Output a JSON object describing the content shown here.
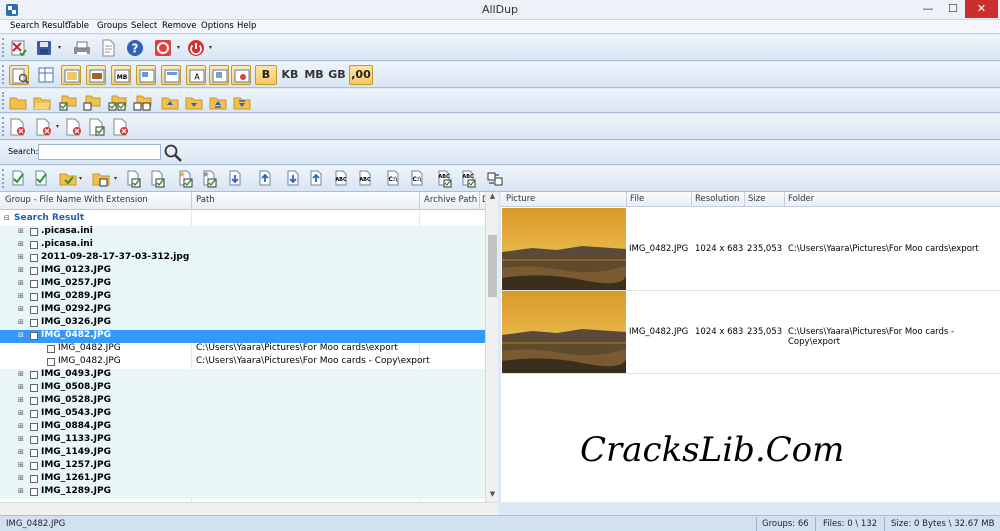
{
  "window": {
    "title": "AllDup",
    "min_glyph": "—",
    "max_glyph": "☐",
    "close_glyph": "✕"
  },
  "menu": [
    "Search Result",
    "Table",
    "Groups",
    "Select",
    "Remove",
    "Options",
    "Help"
  ],
  "toolbar_sizes": {
    "b": "B",
    "kb": "KB",
    "mb": "MB",
    "gb": "GB",
    "dec": ",00"
  },
  "search": {
    "label": "Search:",
    "value": ""
  },
  "left_columns": {
    "group": "Group - File Name With Extension",
    "path": "Path",
    "archive": "Archive Path",
    "more": "D"
  },
  "tree": {
    "root": "Search Result",
    "items": [
      {
        "name": ".picasa.ini"
      },
      {
        "name": ".picasa.ini"
      },
      {
        "name": "2011-09-28-17-37-03-312.jpg"
      },
      {
        "name": "IMG_0123.JPG"
      },
      {
        "name": "IMG_0257.JPG"
      },
      {
        "name": "IMG_0289.JPG"
      },
      {
        "name": "IMG_0292.JPG"
      },
      {
        "name": "IMG_0326.JPG"
      },
      {
        "name": "IMG_0482.JPG",
        "selected": true
      },
      {
        "name": "IMG_0482.JPG",
        "child": true,
        "path": "C:\\Users\\Yaara\\Pictures\\For Moo cards\\export"
      },
      {
        "name": "IMG_0482.JPG",
        "child": true,
        "path": "C:\\Users\\Yaara\\Pictures\\For Moo cards - Copy\\export"
      },
      {
        "name": "IMG_0493.JPG"
      },
      {
        "name": "IMG_0508.JPG"
      },
      {
        "name": "IMG_0528.JPG"
      },
      {
        "name": "IMG_0543.JPG"
      },
      {
        "name": "IMG_0884.JPG"
      },
      {
        "name": "IMG_1133.JPG"
      },
      {
        "name": "IMG_1149.JPG"
      },
      {
        "name": "IMG_1257.JPG"
      },
      {
        "name": "IMG_1261.JPG"
      },
      {
        "name": "IMG_1289.JPG"
      }
    ]
  },
  "right_columns": {
    "picture": "Picture",
    "file": "File",
    "resolution": "Resolution",
    "size": "Size",
    "folder": "Folder"
  },
  "right_rows": [
    {
      "file": "IMG_0482.JPG",
      "resolution": "1024 x 683",
      "size": "235,053",
      "folder": "C:\\Users\\Yaara\\Pictures\\For Moo cards\\export"
    },
    {
      "file": "IMG_0482.JPG",
      "resolution": "1024 x 683",
      "size": "235,053",
      "folder": "C:\\Users\\Yaara\\Pictures\\For Moo cards - Copy\\export"
    }
  ],
  "watermark": "CracksLib.Com",
  "status": {
    "current": "IMG_0482.JPG",
    "groups": "Groups: 66",
    "files": "Files: 0 \\ 132",
    "size": "Size: 0 Bytes \\ 32.67 MB"
  },
  "colors": {
    "selection": "#3399ff",
    "close": "#c9302c",
    "shade": "#e9f6f8"
  }
}
